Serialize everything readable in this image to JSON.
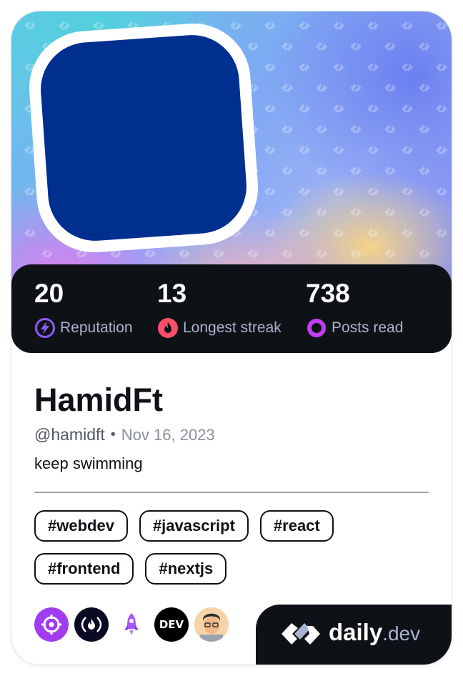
{
  "profile": {
    "name": "HamidFt",
    "handle": "@hamidft",
    "separator": "•",
    "joined": "Nov 16, 2023",
    "bio": "keep swimming",
    "avatar_color": "#00308f"
  },
  "stats": [
    {
      "value": "20",
      "label": "Reputation",
      "icon": "lightning-icon",
      "color": "#8b5cf6"
    },
    {
      "value": "13",
      "label": "Longest streak",
      "icon": "flame-icon",
      "color": "#ff4d6a"
    },
    {
      "value": "738",
      "label": "Posts read",
      "icon": "ring-icon",
      "color": "#c33cf5"
    }
  ],
  "tags": [
    "#webdev",
    "#javascript",
    "#react",
    "#frontend",
    "#nextjs"
  ],
  "sources": [
    {
      "icon": "crosshair-source-icon",
      "color": "#a23cf0"
    },
    {
      "icon": "freecodecamp-source-icon",
      "color": "#0a0a23"
    },
    {
      "icon": "rocket-source-icon",
      "color": "#a855f7"
    },
    {
      "icon": "dev-to-source-icon",
      "label": "DEV",
      "color": "#000000"
    },
    {
      "icon": "memoji-avatar-source-icon",
      "color": "#f3c99a"
    }
  ],
  "brand": {
    "primary": "daily",
    "secondary": ".dev"
  }
}
